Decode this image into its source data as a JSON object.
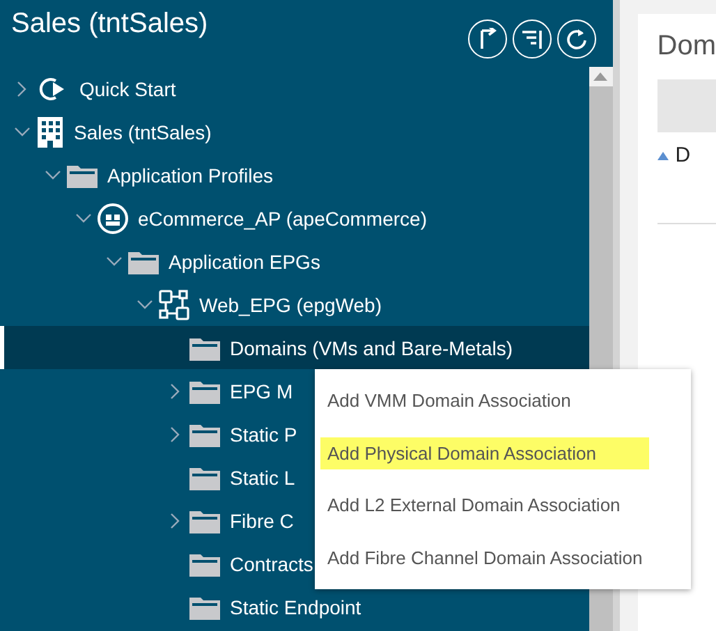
{
  "sidebar": {
    "title": "Sales (tntSales)",
    "toolbar": [
      {
        "kind": "back"
      },
      {
        "kind": "collapse"
      },
      {
        "kind": "refresh"
      }
    ],
    "tree": [
      {
        "label": "Quick Start",
        "kind": "quickstart",
        "expanded": false,
        "selected": false
      },
      {
        "label": "Sales (tntSales)",
        "kind": "tenant",
        "expanded": true,
        "selected": false,
        "children": [
          {
            "label": "Application Profiles",
            "kind": "folder",
            "expanded": true,
            "selected": false,
            "children": [
              {
                "label": "eCommerce_AP (apeCommerce)",
                "kind": "app-profile",
                "expanded": true,
                "selected": false,
                "children": [
                  {
                    "label": "Application EPGs",
                    "kind": "folder",
                    "expanded": true,
                    "selected": false,
                    "children": [
                      {
                        "label": "Web_EPG (epgWeb)",
                        "kind": "epg",
                        "expanded": true,
                        "selected": false,
                        "children": [
                          {
                            "label": "Domains (VMs and Bare-Metals)",
                            "kind": "folder",
                            "selected": true
                          },
                          {
                            "label": "EPG M",
                            "kind": "folder",
                            "expanded": false,
                            "selected": false
                          },
                          {
                            "label": "Static P",
                            "kind": "folder",
                            "expanded": false,
                            "selected": false
                          },
                          {
                            "label": "Static L",
                            "kind": "folder",
                            "selected": false
                          },
                          {
                            "label": "Fibre C",
                            "kind": "folder",
                            "expanded": false,
                            "selected": false
                          },
                          {
                            "label": "Contracts",
                            "kind": "folder",
                            "selected": false
                          },
                          {
                            "label": "Static Endpoint",
                            "kind": "folder",
                            "selected": false
                          }
                        ]
                      }
                    ]
                  }
                ]
              }
            ]
          }
        ]
      }
    ]
  },
  "context_menu": [
    {
      "label": "Add VMM Domain Association",
      "selected": false
    },
    {
      "label": "Add Physical Domain Association",
      "selected": true
    },
    {
      "label": "Add L2 External Domain Association",
      "selected": false
    },
    {
      "label": "Add Fibre Channel Domain Association",
      "selected": false
    }
  ],
  "content": {
    "title": "Dom",
    "column_1": "D"
  }
}
